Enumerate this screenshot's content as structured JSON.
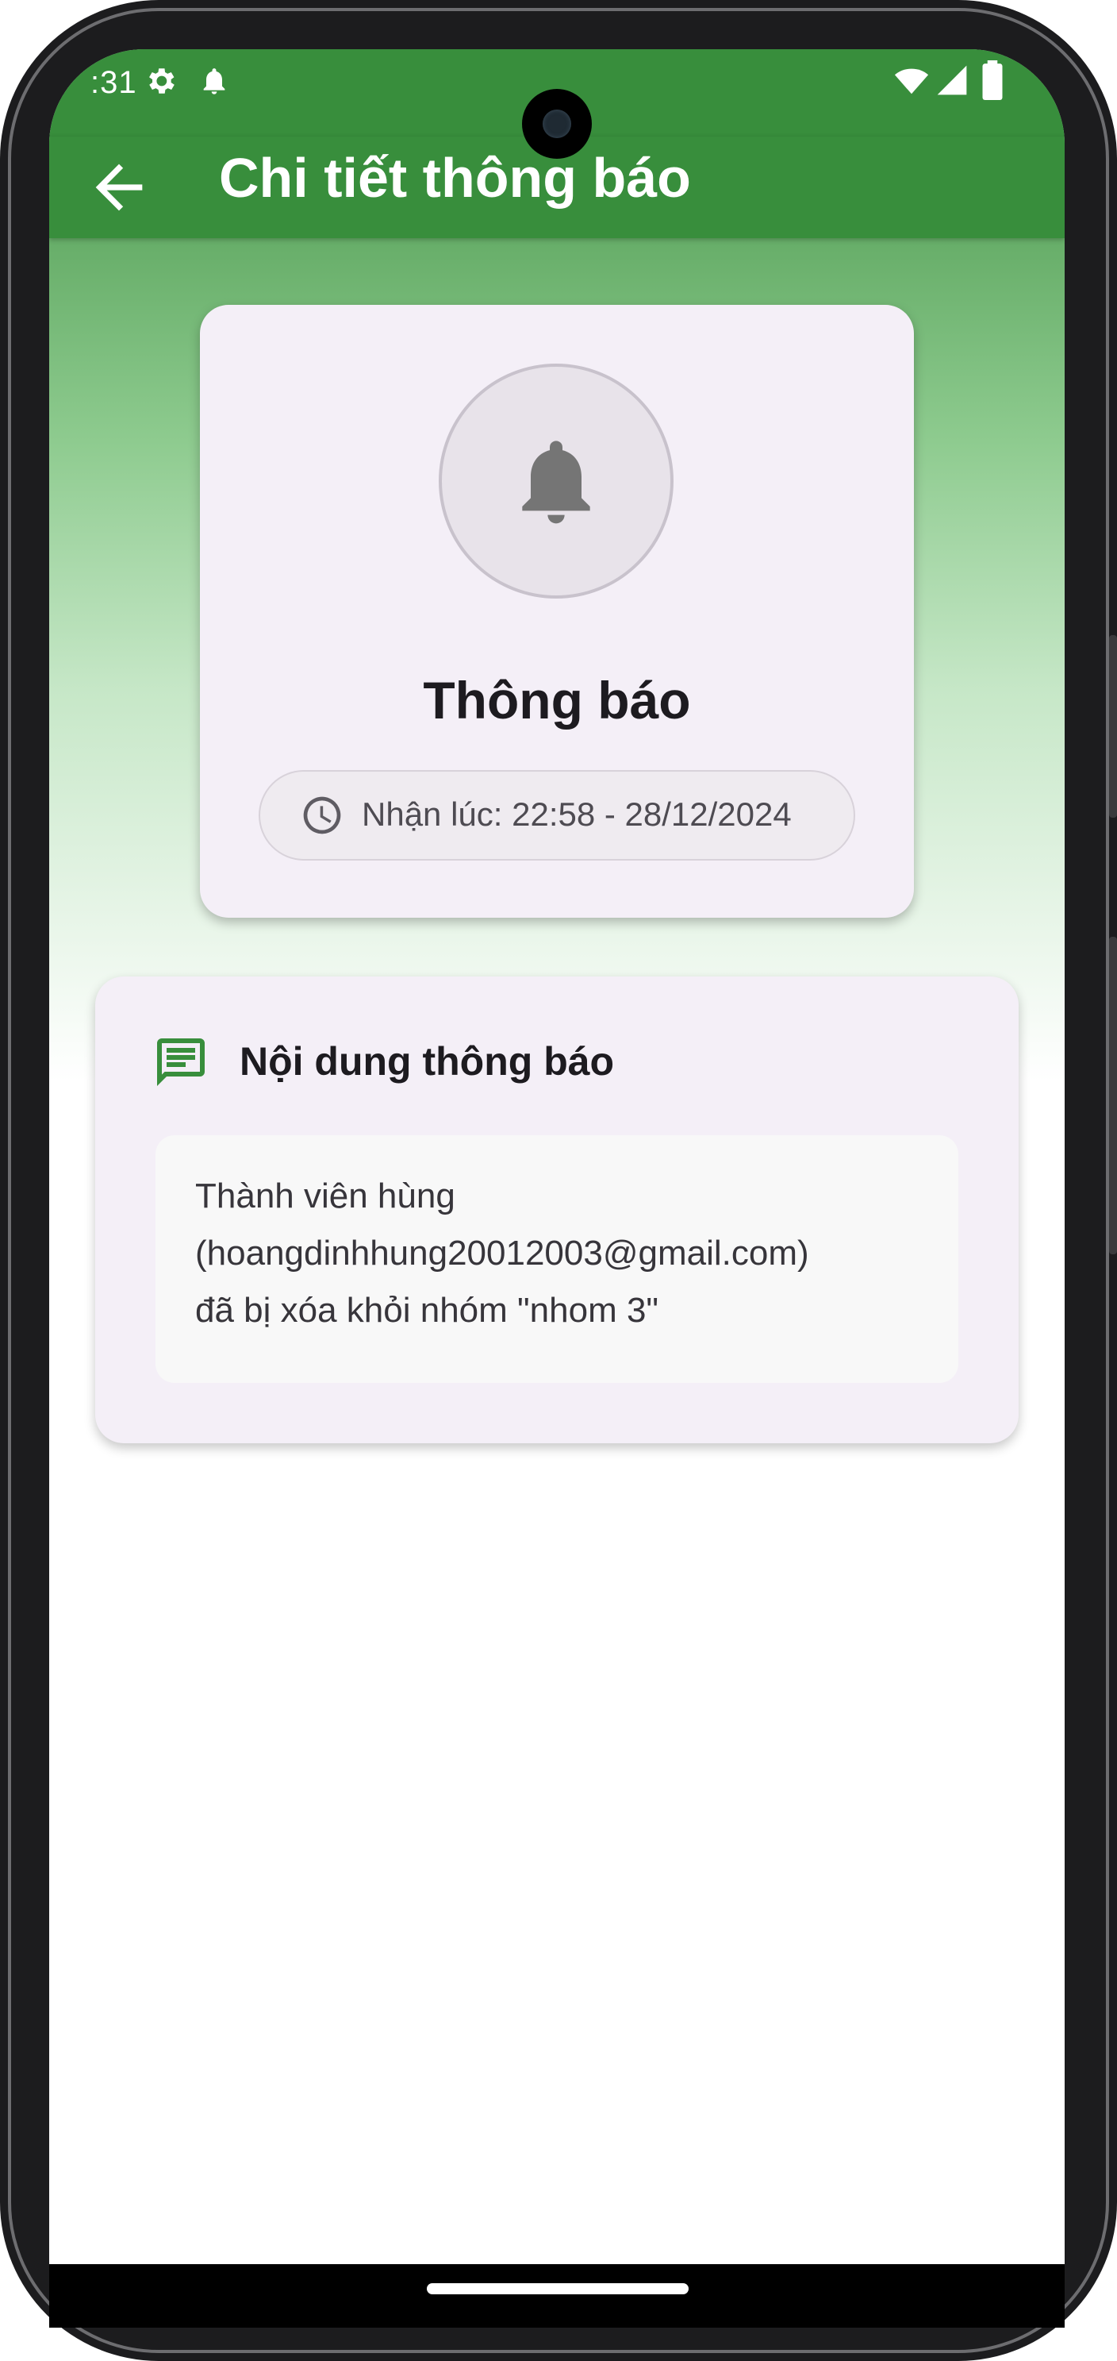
{
  "status_bar": {
    "time": ":31",
    "icons": [
      "gear-icon",
      "bell-icon",
      "wifi-icon",
      "signal-icon",
      "battery-icon"
    ]
  },
  "app_bar": {
    "title": "Chi tiết thông báo",
    "back_icon": "arrow-left-icon"
  },
  "notification": {
    "icon": "bell-icon",
    "title": "Thông báo",
    "received_time": "Nhận lúc: 22:58 - 28/12/2024",
    "time_icon": "clock-icon"
  },
  "content": {
    "icon": "message-icon",
    "heading": "Nội dung thông báo",
    "lines": [
      "Thành viên hùng",
      "(hoangdinhhung20012003@gmail.com)",
      "đã bị xóa khỏi nhóm \"nhom 3\""
    ]
  },
  "colors": {
    "primary_green": "#388e3c",
    "card_bg": "#f4eff7",
    "icon_gray": "#757575"
  }
}
